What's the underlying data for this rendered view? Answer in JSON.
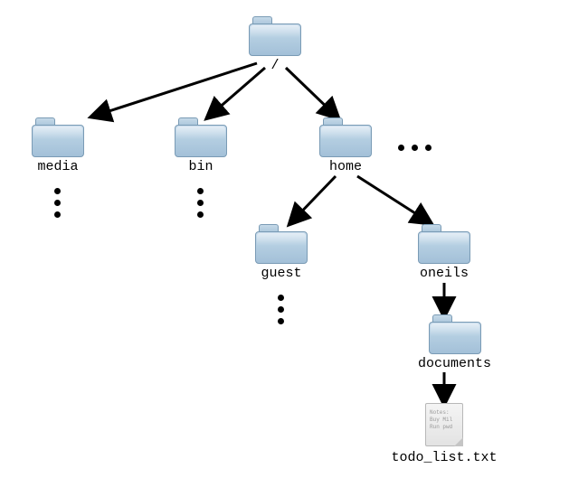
{
  "nodes": {
    "root": {
      "label": "/"
    },
    "media": {
      "label": "media"
    },
    "bin": {
      "label": "bin"
    },
    "home": {
      "label": "home"
    },
    "guest": {
      "label": "guest"
    },
    "oneils": {
      "label": "oneils"
    },
    "documents": {
      "label": "documents"
    },
    "todo": {
      "label": "todo_list.txt"
    }
  },
  "file_preview": {
    "line1": "Notes:",
    "line2": "Buy Mil",
    "line3": "Run pwd"
  }
}
